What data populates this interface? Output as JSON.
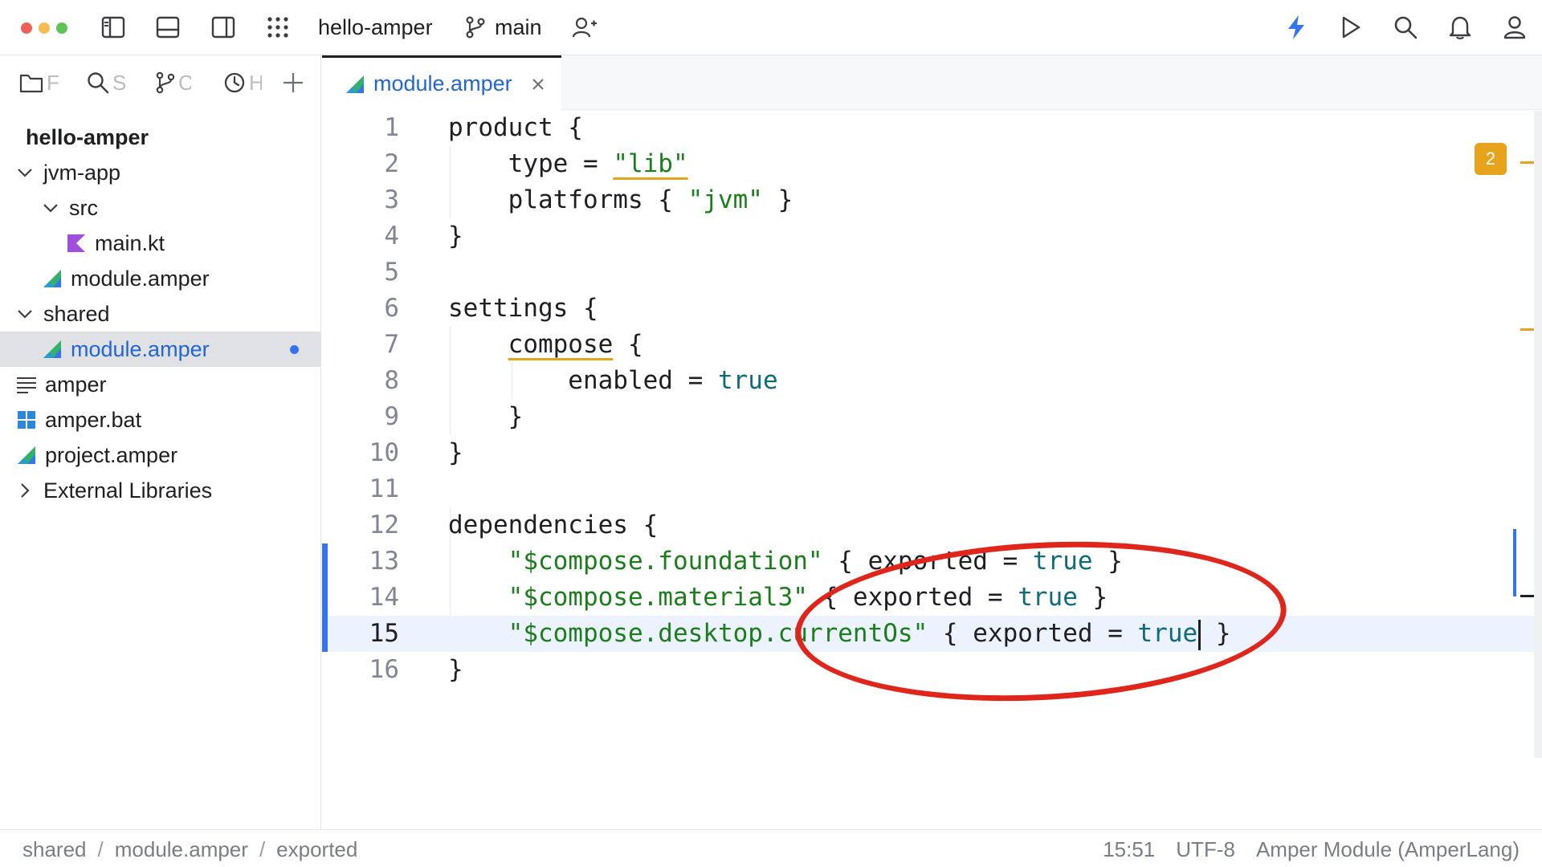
{
  "titlebar": {
    "project_name": "hello-amper",
    "branch": "main"
  },
  "sidebar": {
    "tools": [
      {
        "label": "F",
        "icon": "folder-icon"
      },
      {
        "label": "S",
        "icon": "search-icon"
      },
      {
        "label": "C",
        "icon": "branch-icon"
      },
      {
        "label": "H",
        "icon": "clock-icon"
      }
    ],
    "tree": [
      {
        "label": "hello-amper",
        "icon": "none",
        "selected": false
      },
      {
        "label": "jvm-app",
        "icon": "chevron-down-icon"
      },
      {
        "label": "src",
        "icon": "chevron-down-icon"
      },
      {
        "label": "main.kt",
        "icon": "kotlin-file-icon"
      },
      {
        "label": "module.amper",
        "icon": "amper-file-icon"
      },
      {
        "label": "shared",
        "icon": "chevron-down-icon"
      },
      {
        "label": "module.amper",
        "icon": "amper-file-icon",
        "selected": true,
        "modified": true
      },
      {
        "label": "amper",
        "icon": "text-file-icon"
      },
      {
        "label": "amper.bat",
        "icon": "windows-file-icon"
      },
      {
        "label": "project.amper",
        "icon": "amper-file-icon"
      },
      {
        "label": "External Libraries",
        "icon": "chevron-right-icon"
      }
    ]
  },
  "editor": {
    "tab_label": "module.amper",
    "warning_count": "2",
    "lines": [
      {
        "n": "1",
        "text": "product {"
      },
      {
        "n": "2",
        "pre": "    type = ",
        "str": "\"lib\""
      },
      {
        "n": "3",
        "pre": "    platforms { ",
        "str": "\"jvm\"",
        "post": " }"
      },
      {
        "n": "4",
        "text": "}"
      },
      {
        "n": "5",
        "text": ""
      },
      {
        "n": "6",
        "text": "settings {"
      },
      {
        "n": "7",
        "kw_ul": "compose",
        "post": " {",
        "indent": "    "
      },
      {
        "n": "8",
        "pre": "        enabled = ",
        "kw": "true"
      },
      {
        "n": "9",
        "text": "    }"
      },
      {
        "n": "10",
        "text": "}"
      },
      {
        "n": "11",
        "text": ""
      },
      {
        "n": "12",
        "text": "dependencies {"
      },
      {
        "n": "13",
        "indent": "    ",
        "str": "\"$compose.foundation\"",
        "mid": " { exported = ",
        "kw": "true",
        "post": " }"
      },
      {
        "n": "14",
        "indent": "    ",
        "str": "\"$compose.material3\"",
        "mid": " { exported = ",
        "kw": "true",
        "post": " }"
      },
      {
        "n": "15",
        "indent": "    ",
        "str": "\"$compose.desktop.currentOs\"",
        "mid": " { exported = ",
        "kw": "true",
        "post": " }"
      },
      {
        "n": "16",
        "text": "}"
      }
    ]
  },
  "statusbar": {
    "breadcrumbs": [
      "shared",
      "module.amper",
      "exported"
    ],
    "position": "15:51",
    "encoding": "UTF-8",
    "file_type": "Amper Module (AmperLang)"
  },
  "colors": {
    "accent": "#3574f0",
    "string": "#1a7f1a",
    "keyword": "#0e6b7a",
    "warning": "#e8a31c",
    "annotation": "#e0251b"
  }
}
